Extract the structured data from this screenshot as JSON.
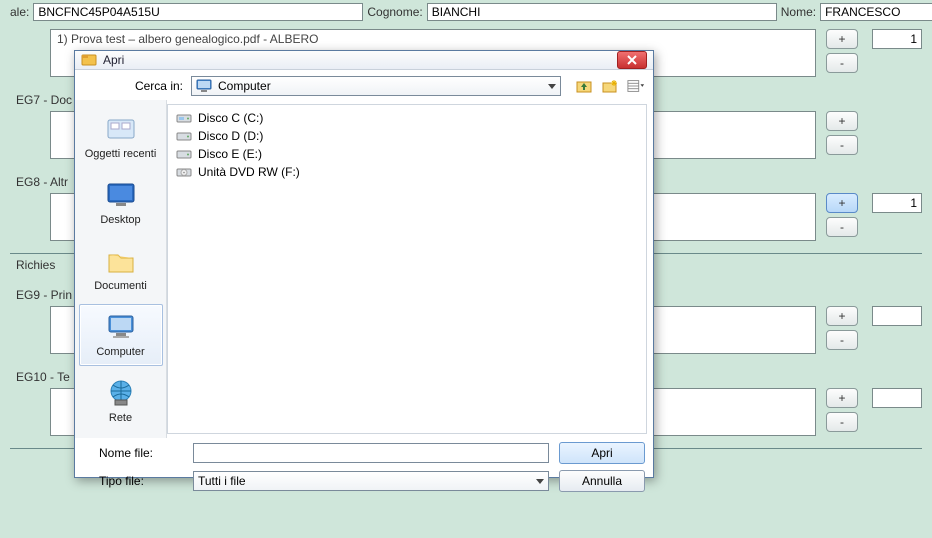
{
  "header": {
    "label_ale": "ale:",
    "value_ale": "BNCFNC45P04A515U",
    "label_cognome": "Cognome:",
    "value_cognome": "BIANCHI",
    "label_nome": "Nome:",
    "value_nome": "FRANCESCO"
  },
  "sections": {
    "s1_file": "1) Prova test – albero genealogico.pdf - ALBERO",
    "eg7_label": "EG7 - Doc",
    "eg8_label": "EG8 - Altr",
    "richies_label": "Richies",
    "eg9_label": "EG9 - Prin",
    "eg10_label": "EG10 - Te",
    "num1": "1",
    "num2": "1",
    "plus": "+",
    "minus": "-"
  },
  "dialog": {
    "title": "Apri",
    "lookin_label": "Cerca in:",
    "lookin_value": "Computer",
    "places": {
      "recent": "Oggetti recenti",
      "desktop": "Desktop",
      "documents": "Documenti",
      "computer": "Computer",
      "network": "Rete"
    },
    "drives": [
      {
        "icon": "hdd",
        "label": "Disco C (C:)"
      },
      {
        "icon": "hdd",
        "label": "Disco D (D:)"
      },
      {
        "icon": "hdd",
        "label": "Disco E (E:)"
      },
      {
        "icon": "dvd",
        "label": "Unità DVD RW (F:)"
      }
    ],
    "filename_label": "Nome file:",
    "filename_value": "",
    "filetype_label": "Tipo file:",
    "filetype_value": "Tutti i file",
    "open_btn": "Apri",
    "cancel_btn": "Annulla"
  }
}
